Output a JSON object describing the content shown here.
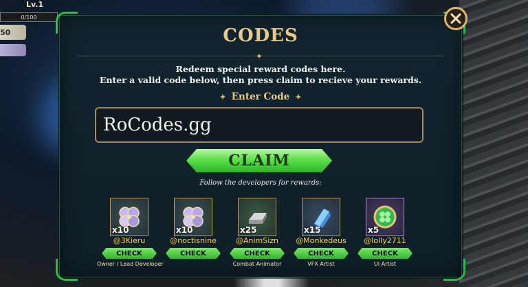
{
  "hud": {
    "level": "Lv.1",
    "xp": "0/100",
    "stat": "50"
  },
  "dialog": {
    "title": "CODES",
    "desc_line1": "Redeem special reward codes here.",
    "desc_line2": "Enter a valid code below, then press claim to recieve your rewards.",
    "enter_label": "Enter Code",
    "code_value": "RoCodes.gg",
    "claim_label": "CLAIM",
    "follow_text": "Follow the developers for rewards:"
  },
  "developers": [
    {
      "qty": "x10",
      "handle": "@3Kieru",
      "check": "CHECK",
      "role": "Owner / Lead Developer",
      "icon": "clover-gem-icon"
    },
    {
      "qty": "x10",
      "handle": "@noctisnine",
      "check": "CHECK",
      "role": "",
      "icon": "clover-gem-icon"
    },
    {
      "qty": "x25",
      "handle": "@AnimSizn",
      "check": "CHECK",
      "role": "Combat Animator",
      "icon": "silver-ingot-icon"
    },
    {
      "qty": "x15",
      "handle": "@Monkedeus",
      "check": "CHECK",
      "role": "VFX Artist",
      "icon": "blue-crystal-icon"
    },
    {
      "qty": "x5",
      "handle": "@lolly2711",
      "check": "CHECK",
      "role": "UI Artist",
      "icon": "green-clover-coin-icon"
    }
  ],
  "colors": {
    "accent_gold": "#e9c98a",
    "accent_green": "#2fb84c",
    "handle_yellow": "#ffd34d"
  }
}
